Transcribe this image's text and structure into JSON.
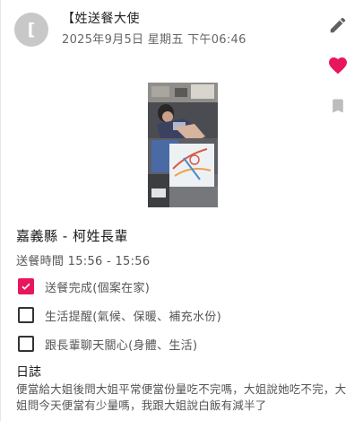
{
  "post": {
    "avatar_initial": "[",
    "author": "【姓送餐大使",
    "date": "2025年9月5日 星期五 下午06:46"
  },
  "actions": {
    "edit_icon": "pencil-icon",
    "like_icon": "heart-icon",
    "bookmark_icon": "bookmark-icon",
    "like_color": "#e8175d",
    "icon_color": "#616161",
    "bookmark_color": "#bdbdbd"
  },
  "record": {
    "place": "嘉義縣 - 柯姓長輩",
    "time": "送餐時間 15:56 - 15:56"
  },
  "tasks": [
    {
      "label": "送餐完成(個案在家)",
      "checked": true
    },
    {
      "label": "生活提醒(氣候、保暖、補充水份)",
      "checked": false
    },
    {
      "label": "跟長輩聊天關心(身體、生活)",
      "checked": false
    }
  ],
  "log": {
    "title": "日誌",
    "body": "便當給大姐後問大姐平常便當份量吃不完嗎，大姐說她吃不完，大姐問今天便當有少量嗎，我跟大姐說白飯有減半了"
  }
}
